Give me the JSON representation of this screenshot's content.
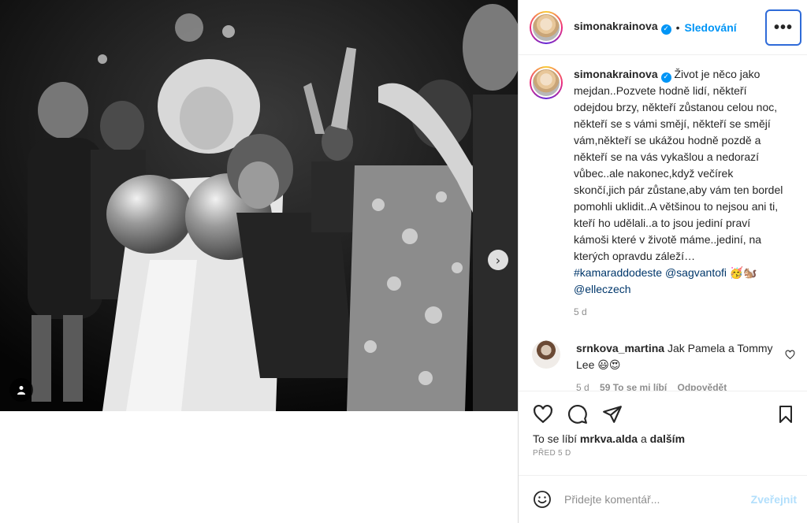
{
  "post": {
    "username": "simonakrainova",
    "follow_label": "Sledování",
    "more_label": "•••",
    "caption": "Život je něco jako mejdan..Pozvete hodně lidí, někteří odejdou brzy, někteří zůstanou celou noc, někteří se s vámi smějí, někteří se smějí vám,někteří se ukážou hodně pozdě a někteří se na vás vykašlou a nedorazí vůbec..ale nakonec,když večírek skončí,jich pár zůstane,aby vám ten bordel pomohli uklidit..A většinou to nejsou ani ti, kteří ho udělali..a to jsou jediní praví kámoši které v životě máme..jediní, na kterých opravdu záleží…",
    "hashtags": "#kamaraddodeste @sagvantofi 🥳🐿️ @elleczech",
    "caption_age": "5 d"
  },
  "comments": [
    {
      "username": "srnkova_martina",
      "text": "Jak Pamela a Tommy Lee 😃😍",
      "age": "5 d",
      "likes": "59 To se mi líbí",
      "reply_label": "Odpovědět"
    }
  ],
  "likes": {
    "prefix": "To se líbí",
    "user": "mrkva.alda",
    "joiner": "a",
    "others": "dalším"
  },
  "timestamp": "PŘED 5 D",
  "comment_box": {
    "placeholder": "Přidejte komentář...",
    "post_label": "Zveřejnit"
  },
  "icons": {
    "like": "heart-icon",
    "comment": "comment-icon",
    "share": "share-icon",
    "save": "bookmark-icon",
    "emoji": "emoji-icon",
    "next": "chevron-right-icon",
    "tagged": "user-tag-icon"
  },
  "colors": {
    "accent": "#0095f6",
    "link": "#00376b",
    "muted": "#8e8e8e"
  }
}
